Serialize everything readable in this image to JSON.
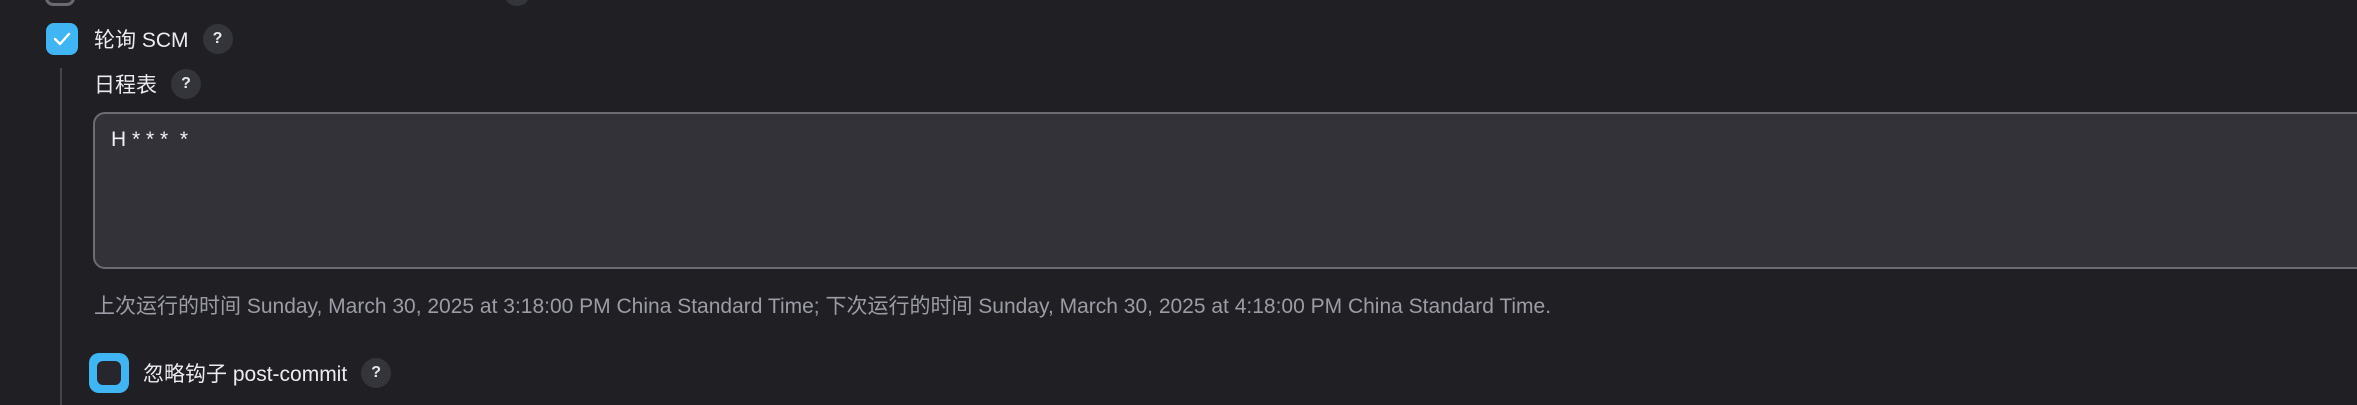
{
  "polling_scm": {
    "checked": true,
    "label": "轮询 SCM",
    "help": "?"
  },
  "schedule": {
    "label": "日程表",
    "help": "?",
    "value": "H * * *  *"
  },
  "run_info": "上次运行的时间 Sunday, March 30, 2025 at 3:18:00 PM China Standard Time; 下次运行的时间 Sunday, March 30, 2025 at 4:18:00 PM China Standard Time.",
  "ignore_post_commit": {
    "checked": false,
    "label": "忽略钩子 post-commit",
    "help": "?"
  },
  "colors": {
    "background": "#1f1f24",
    "accent": "#3fb6f3",
    "muted_text": "#9c9ca6"
  }
}
